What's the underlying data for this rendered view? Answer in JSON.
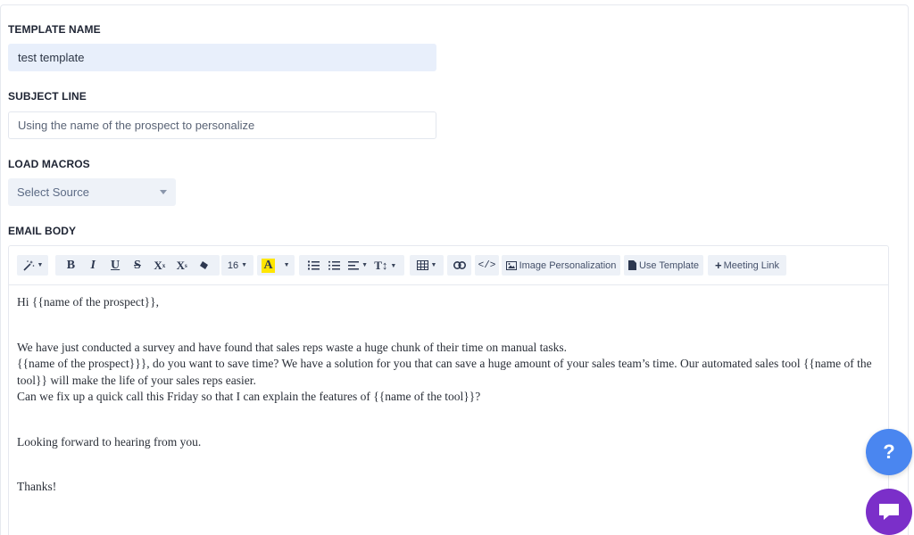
{
  "form": {
    "template_name_label": "TEMPLATE NAME",
    "template_name_value": "test template",
    "subject_line_label": "SUBJECT LINE",
    "subject_line_placeholder": "Using the name of the prospect to personalize",
    "load_macros_label": "LOAD MACROS",
    "select_source": "Select Source",
    "email_body_label": "EMAIL BODY"
  },
  "toolbar": {
    "magic_icon": "magic-wand-icon",
    "bold": "B",
    "italic": "I",
    "underline": "U",
    "strike": "S",
    "superscript": "X",
    "superscript_mark": "x",
    "subscript": "X",
    "subscript_mark": "s",
    "font_size": "16",
    "font_color": "A",
    "highlight_color": "#ffe600",
    "image_personalization": "Image Personalization",
    "use_template": "Use Template",
    "meeting_link": "Meeting Link"
  },
  "email_body": {
    "line1": "Hi  {{name of the prospect}},",
    "line2": "We have just conducted a survey and have found that sales reps waste a huge chunk of their time on manual tasks.",
    "line3": "{{name of the prospect}}}, do you want to save time? We have a solution for you that can save a huge amount of your sales team’s time. Our automated sales tool {{name of the tool}} will make the life of your sales reps easier.",
    "line4": "Can we fix up a quick call this Friday so that I can explain the features of  {{name of the tool}}?",
    "line5": "Looking forward to hearing from you.",
    "line6": "Thanks!"
  },
  "floating": {
    "help_label": "?"
  },
  "colors": {
    "accent_blue": "#4a86f0",
    "chat_purple": "#7b2fc9"
  }
}
